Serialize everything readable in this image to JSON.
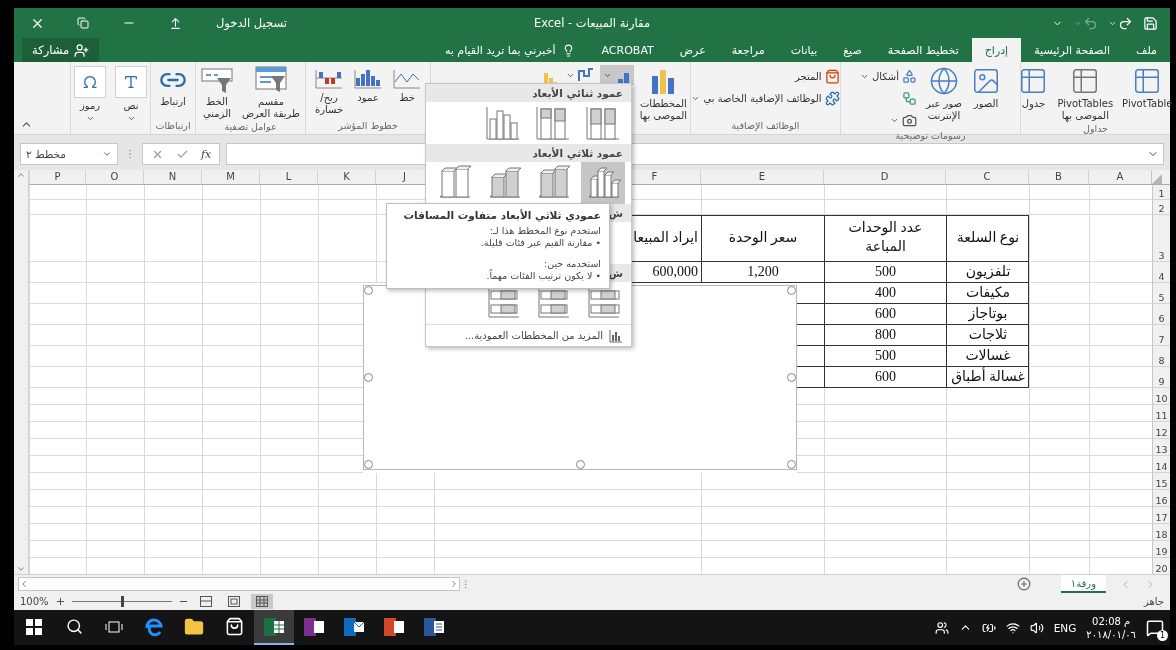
{
  "window": {
    "title": "مقارنة المبيعات - Excel",
    "sign_in": "تسجيل الدخول"
  },
  "quick_access": [
    {
      "kind": "save",
      "disabled": false
    },
    {
      "kind": "redo",
      "disabled": false
    },
    {
      "kind": "undo",
      "disabled": true
    },
    {
      "kind": "customize",
      "disabled": false
    }
  ],
  "tabs": [
    {
      "label": "ملف",
      "selected": false
    },
    {
      "label": "الصفحة الرئيسية",
      "selected": false
    },
    {
      "label": "إدراج",
      "selected": true
    },
    {
      "label": "تخطيط الصفحة",
      "selected": false
    },
    {
      "label": "صيغ",
      "selected": false
    },
    {
      "label": "بيانات",
      "selected": false
    },
    {
      "label": "مراجعة",
      "selected": false
    },
    {
      "label": "عرض",
      "selected": false
    },
    {
      "label": "ACROBAT",
      "selected": false
    }
  ],
  "tell_me": {
    "placeholder": "أخبرني بما تريد القيام به"
  },
  "share": "مشاركة",
  "ribbon": {
    "tables": {
      "label": "جداول",
      "buttons": [
        "PivotTable",
        "PivotTables\nالموصى بها",
        "جدول"
      ]
    },
    "illustrations": {
      "label": "رسومات توضيحية",
      "buttons": [
        "الصور",
        "صور عبر\nالإنترنت"
      ],
      "shapes": "أشكال"
    },
    "addins": {
      "label": "الوظائف الإضافية",
      "store": "المتجر",
      "my_addins": "الوظائف الإضافية الخاصة بي"
    },
    "charts": {
      "recommended": "المخططات\nالموصى بها",
      "buttons": [
        {
          "selected": true
        },
        {
          "selected": false
        },
        {
          "selected": false
        }
      ]
    },
    "sparklines": {
      "label": "خطوط المؤشر",
      "buttons": [
        "خط",
        "عمود",
        "ربح/\nخسارة"
      ]
    },
    "filters": {
      "label": "عوامل تصفية",
      "buttons": [
        "مقسم\nطريقة العرض",
        "الخط\nالزمني"
      ]
    },
    "links": {
      "label": "ارتباطات",
      "buttons": [
        "ارتباط"
      ]
    },
    "text_symbols": {
      "buttons": [
        "نص",
        "رموز"
      ]
    }
  },
  "formula_bar": {
    "name_box": "مخطط ٢",
    "function_label": "fx"
  },
  "sheet": {
    "columns": [
      "A",
      "B",
      "C",
      "D",
      "E",
      "F",
      "J",
      "K",
      "L",
      "M",
      "N",
      "O",
      "P"
    ],
    "rows": [
      "1",
      "2",
      "3",
      "4",
      "5",
      "6",
      "7",
      "8",
      "9",
      "10",
      "11",
      "12",
      "13",
      "14",
      "15",
      "16",
      "17",
      "18",
      "19",
      "20"
    ],
    "table": {
      "header": [
        "نوع السلعة",
        "عدد الوحدات\nالمباعة",
        "سعر الوحدة",
        "ايراد المبيعا"
      ],
      "rows": [
        [
          "تلفزيون",
          "500",
          "1,200",
          "600,000"
        ],
        [
          "مكيفات",
          "400"
        ],
        [
          "بوتاجاز",
          "600"
        ],
        [
          "ثلاجات",
          "800"
        ],
        [
          "غسالات",
          "500"
        ],
        [
          "غسالة أطباق",
          "600"
        ]
      ]
    }
  },
  "chart_menu": {
    "sections": [
      {
        "title": "عمود ثنائي الأبعاد",
        "kind": "column2d",
        "options": [
          {
            "selected": false
          },
          {
            "selected": false
          },
          {
            "selected": false
          }
        ]
      },
      {
        "title": "عمود ثلاثي الأبعاد",
        "kind": "column3d",
        "options": [
          {
            "selected": true
          },
          {
            "selected": false
          },
          {
            "selected": false
          },
          {
            "selected": false
          }
        ]
      },
      {
        "title": "ش"
      },
      {
        "title": "ش",
        "kind": "bar3d",
        "options": [
          {
            "selected": false
          },
          {
            "selected": false
          },
          {
            "selected": false
          }
        ]
      }
    ],
    "more": "المزيد من المخططات العمودية..."
  },
  "tooltip": {
    "title": "عمودي ثلاثي الأبعاد متفاوت المسافات",
    "sections": [
      {
        "heading": "استخدم نوع المخطط هذا لـ:",
        "bullet": "• مقارنة القيم عبر فئات قليلة."
      },
      {
        "heading": "استخدمه حين:",
        "bullet": "• لا يكون ترتيب الفئات مهماً."
      }
    ]
  },
  "sheet_tabs": [
    {
      "label": "ورقة١",
      "selected": true
    }
  ],
  "status_bar": {
    "text": "جاهز",
    "zoom": "100%",
    "zoom_slider": {
      "level": 0.5
    },
    "views": [
      {
        "selected": false
      },
      {
        "selected": false
      },
      {
        "selected": true
      }
    ]
  },
  "taskbar": {
    "apps": [
      {
        "kind": "start",
        "active": false
      },
      {
        "kind": "search",
        "active": false
      },
      {
        "kind": "taskview",
        "active": false
      },
      {
        "kind": "browser",
        "active": false
      },
      {
        "kind": "folder",
        "active": false
      },
      {
        "kind": "store",
        "active": false
      },
      {
        "kind": "spreadsheet",
        "active": true
      },
      {
        "kind": "notebook",
        "active": false
      },
      {
        "kind": "mail",
        "active": false
      },
      {
        "kind": "presentation",
        "active": false
      },
      {
        "kind": "document",
        "active": false
      }
    ],
    "language": "ENG",
    "time": "02:08 م",
    "date": "٢٠١٨/٠١/٠٦",
    "notifications": "1"
  }
}
